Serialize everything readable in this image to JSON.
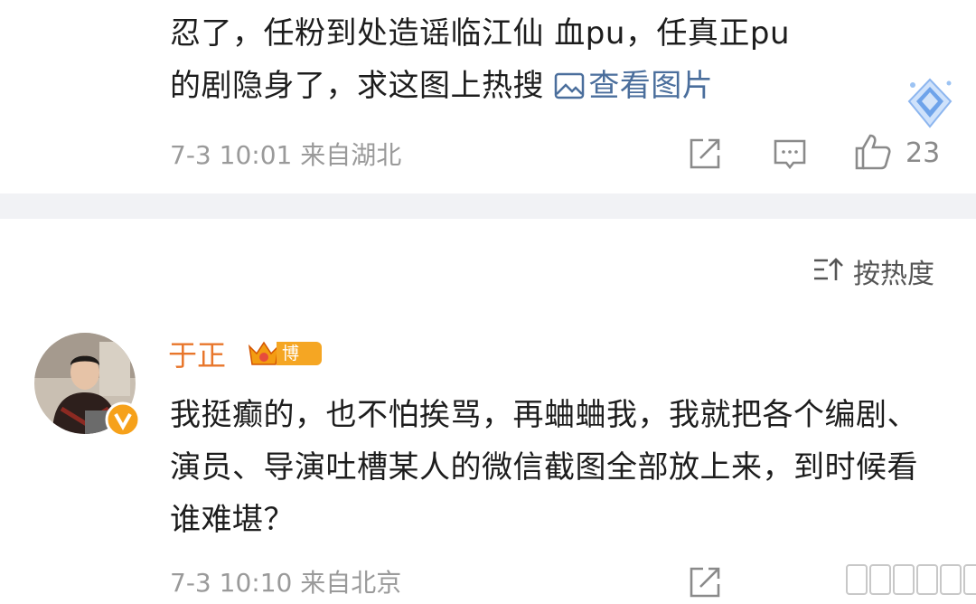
{
  "top_comment": {
    "text_line1": "忍了，任粉到处造谣临江仙 血pu，任真正pu",
    "text_line2": "的剧隐身了，求这图上热搜",
    "view_image_label": "查看图片",
    "timestamp": "7-3 10:01",
    "location": "来自湖北",
    "like_count": "23"
  },
  "sort": {
    "label": "按热度"
  },
  "main_comment": {
    "username": "于正",
    "badge_label": "博主",
    "text": "我挺癫的，也不怕挨骂，再蛐蛐我，我就把各个编剧、演员、导演吐槽某人的微信截图全部放上来，到时候看谁难堪？",
    "timestamp": "7-3 10:10",
    "location": "来自北京"
  },
  "colors": {
    "link": "#4a6e9c",
    "username": "#e8762b",
    "badge": "#f5a623",
    "meta": "#9a9a9a"
  },
  "icons": [
    "image-icon",
    "share-icon",
    "comment-icon",
    "like-icon",
    "sort-icon",
    "verified-icon",
    "crown-icon",
    "diamond-icon"
  ]
}
